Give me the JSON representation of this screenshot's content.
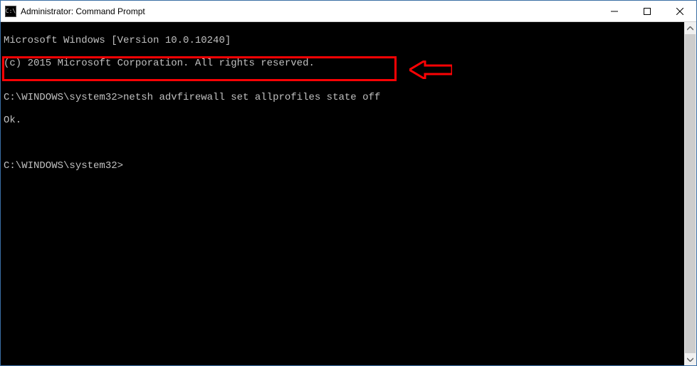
{
  "window": {
    "title": "Administrator: Command Prompt"
  },
  "console": {
    "line1": "Microsoft Windows [Version 10.0.10240]",
    "line2": "(c) 2015 Microsoft Corporation. All rights reserved.",
    "blank1": "",
    "prompt1_path": "C:\\WINDOWS\\system32>",
    "prompt1_cmd": "netsh advfirewall set allprofiles state off",
    "response": "Ok.",
    "blank2": "",
    "blank3": "",
    "prompt2_path": "C:\\WINDOWS\\system32>",
    "prompt2_cmd": ""
  },
  "annotation": {
    "highlight_color": "#fc0204"
  }
}
